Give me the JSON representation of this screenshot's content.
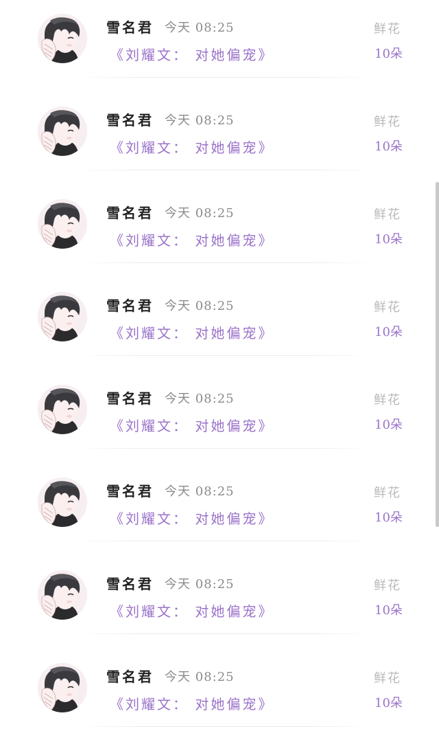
{
  "gifts": [
    {
      "user": "雪名君",
      "time": "今天 08:25",
      "book": "《刘耀文： 对她偏宠》",
      "gift_label": "鲜花",
      "gift_count": "10朵"
    },
    {
      "user": "雪名君",
      "time": "今天 08:25",
      "book": "《刘耀文： 对她偏宠》",
      "gift_label": "鲜花",
      "gift_count": "10朵"
    },
    {
      "user": "雪名君",
      "time": "今天 08:25",
      "book": "《刘耀文： 对她偏宠》",
      "gift_label": "鲜花",
      "gift_count": "10朵"
    },
    {
      "user": "雪名君",
      "time": "今天 08:25",
      "book": "《刘耀文： 对她偏宠》",
      "gift_label": "鲜花",
      "gift_count": "10朵"
    },
    {
      "user": "雪名君",
      "time": "今天 08:25",
      "book": "《刘耀文： 对她偏宠》",
      "gift_label": "鲜花",
      "gift_count": "10朵"
    },
    {
      "user": "雪名君",
      "time": "今天 08:25",
      "book": "《刘耀文： 对她偏宠》",
      "gift_label": "鲜花",
      "gift_count": "10朵"
    },
    {
      "user": "雪名君",
      "time": "今天 08:25",
      "book": "《刘耀文： 对她偏宠》",
      "gift_label": "鲜花",
      "gift_count": "10朵"
    },
    {
      "user": "雪名君",
      "time": "今天 08:25",
      "book": "《刘耀文： 对她偏宠》",
      "gift_label": "鲜花",
      "gift_count": "10朵"
    }
  ],
  "colors": {
    "accent": "#9a72c9",
    "name": "#222222",
    "muted": "#8a8a8a",
    "label": "#b9b9b9"
  },
  "icons": {
    "avatar": "anime-boy-avatar-icon"
  }
}
